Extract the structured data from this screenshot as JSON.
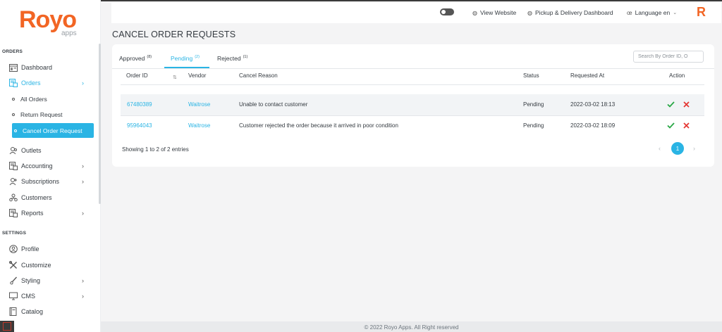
{
  "brand": {
    "logo_main": "Royo",
    "logo_sub": "apps",
    "topbar_letter": "R"
  },
  "sidebar": {
    "orders_section": "ORDERS",
    "settings_section": "SETTINGS",
    "items": {
      "dashboard": "Dashboard",
      "orders": "Orders",
      "all_orders": "All Orders",
      "return_request": "Return Request",
      "cancel_order_request": "Cancel Order Request",
      "outlets": "Outlets",
      "accounting": "Accounting",
      "subscriptions": "Subscriptions",
      "customers": "Customers",
      "reports": "Reports",
      "profile": "Profile",
      "customize": "Customize",
      "styling": "Styling",
      "cms": "CMS",
      "catalog": "Catalog"
    }
  },
  "topbar": {
    "view_website": "View Website",
    "pickup_dashboard": "Pickup & Delivery Dashboard",
    "language": "Language en"
  },
  "page": {
    "title": "CANCEL ORDER REQUESTS"
  },
  "tabs": {
    "approved": {
      "label": "Approved",
      "count": "(8)"
    },
    "pending": {
      "label": "Pending",
      "count": "(2)"
    },
    "rejected": {
      "label": "Rejected",
      "count": "(1)"
    }
  },
  "search": {
    "placeholder": "Search By Order ID, O"
  },
  "table": {
    "headers": {
      "order_id": "Order ID",
      "vendor": "Vendor",
      "reason": "Cancel Reason",
      "status": "Status",
      "requested_at": "Requested At",
      "action": "Action"
    },
    "rows": [
      {
        "order_id": "67480389",
        "vendor": "Waitrose",
        "reason": "Unable to contact customer",
        "status": "Pending",
        "requested_at": "2022-03-02 18:13"
      },
      {
        "order_id": "95964043",
        "vendor": "Waitrose",
        "reason": "Customer rejected the order because it arrived in poor condition",
        "status": "Pending",
        "requested_at": "2022-03-02 18:09"
      }
    ],
    "info": "Showing 1 to 2 of 2 entries",
    "pagination": {
      "prev": "‹",
      "current": "1",
      "next": "›"
    }
  },
  "footer": {
    "text": "© 2022 Royo Apps. All Right reserved"
  },
  "colors": {
    "accent": "#2ab4e4",
    "brand": "#f26524",
    "approve": "#28a745",
    "reject": "#e53935"
  }
}
